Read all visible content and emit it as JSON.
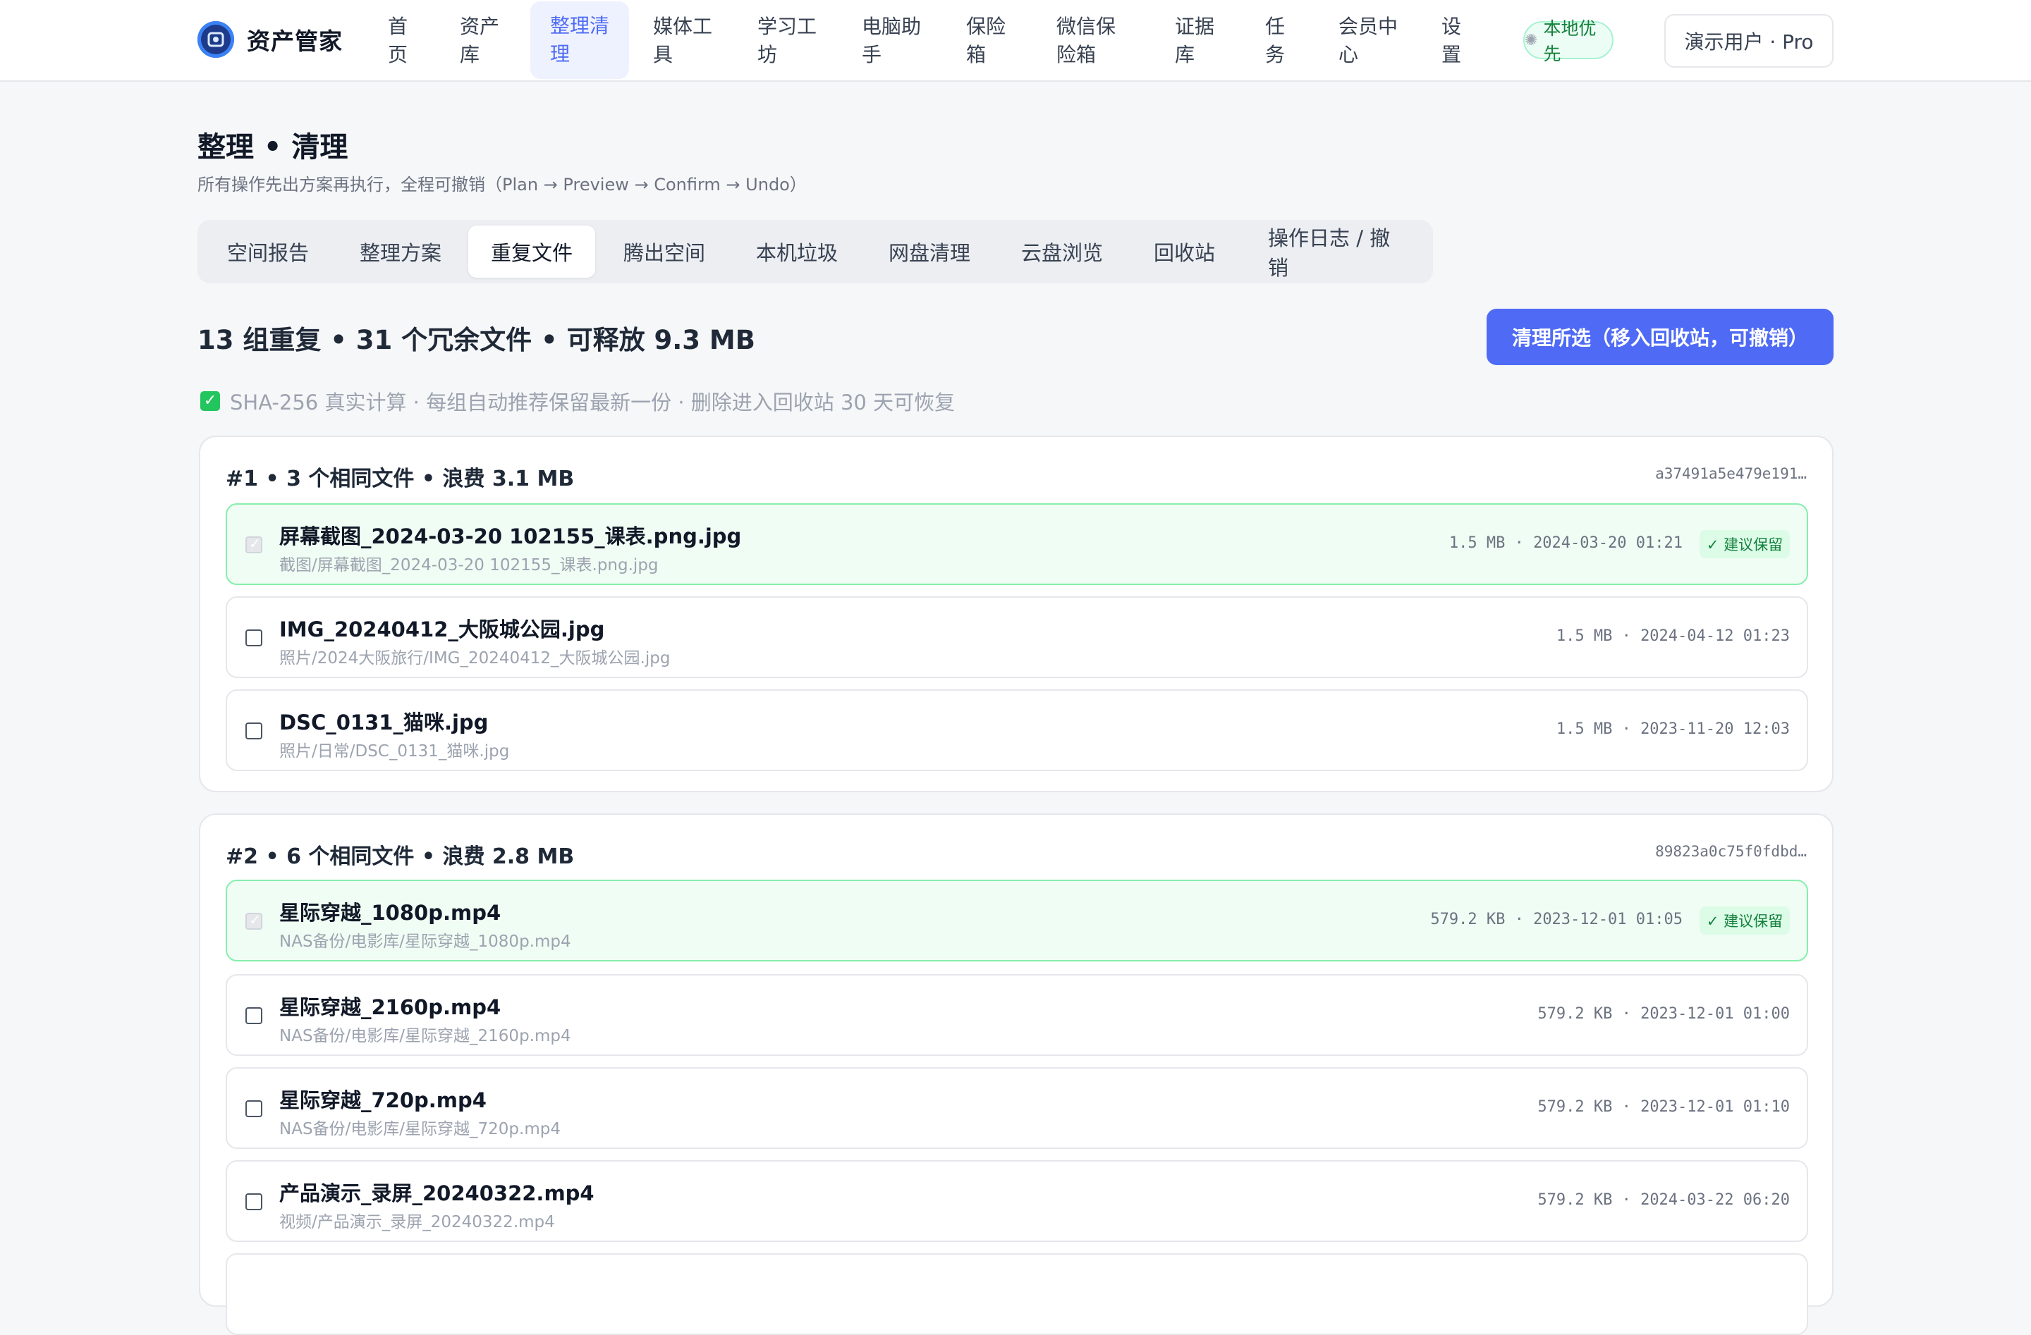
{
  "brand": {
    "name": "资产管家"
  },
  "nav": [
    {
      "label": "首\n页"
    },
    {
      "label": "资产\n库"
    },
    {
      "label": "整理清\n理"
    },
    {
      "label": "媒体工\n具"
    },
    {
      "label": "学习工\n坊"
    },
    {
      "label": "电脑助\n手"
    },
    {
      "label": "保险\n箱"
    },
    {
      "label": "微信保\n险箱"
    },
    {
      "label": "证据\n库"
    },
    {
      "label": "任\n务"
    },
    {
      "label": "会员中\n心"
    },
    {
      "label": "设\n置"
    }
  ],
  "nav_active": "整理清理",
  "local_badge": "本地优先",
  "user": "演示用户 · Pro",
  "page": {
    "title": "整理 • 清理",
    "subtitle": "所有操作先出方案再执行，全程可撤销（Plan → Preview → Confirm → Undo）"
  },
  "tabs": [
    {
      "label": "空间报告"
    },
    {
      "label": "整理方案"
    },
    {
      "label": "重复文件"
    },
    {
      "label": "腾出空间"
    },
    {
      "label": "本机垃圾"
    },
    {
      "label": "网盘清理"
    },
    {
      "label": "云盘浏览"
    },
    {
      "label": "回收站"
    },
    {
      "label": "操作日志 / 撤销"
    }
  ],
  "tab_active": "重复文件",
  "summary": "13 组重复 • 31 个冗余文件 • 可释放 9.3 MB",
  "primary_action": "清理所选（移入回收站，可撤销）",
  "note": "SHA-256 真实计算 · 每组自动推荐保留最新一份 · 删除进入回收站 30 天可恢复",
  "keep_badge": "✓ 建议保留",
  "groups": [
    {
      "title": "#1 • 3 个相同文件 • 浪费 3.1 MB",
      "hash": "a37491a5e479e191…",
      "files": [
        {
          "name": "屏幕截图_2024-03-20 102155_课表.png.jpg",
          "path": "截图/屏幕截图_2024-03-20 102155_课表.png.jpg",
          "meta": "1.5 MB · 2024-03-20 01:21",
          "keep": true
        },
        {
          "name": "IMG_20240412_大阪城公园.jpg",
          "path": "照片/2024大阪旅行/IMG_20240412_大阪城公园.jpg",
          "meta": "1.5 MB · 2024-04-12 01:23",
          "keep": false
        },
        {
          "name": "DSC_0131_猫咪.jpg",
          "path": "照片/日常/DSC_0131_猫咪.jpg",
          "meta": "1.5 MB · 2023-11-20 12:03",
          "keep": false
        }
      ]
    },
    {
      "title": "#2 • 6 个相同文件 • 浪费 2.8 MB",
      "hash": "89823a0c75f0fdbd…",
      "files": [
        {
          "name": "星际穿越_1080p.mp4",
          "path": "NAS备份/电影库/星际穿越_1080p.mp4",
          "meta": "579.2 KB · 2023-12-01 01:05",
          "keep": true
        },
        {
          "name": "星际穿越_2160p.mp4",
          "path": "NAS备份/电影库/星际穿越_2160p.mp4",
          "meta": "579.2 KB · 2023-12-01 01:00",
          "keep": false
        },
        {
          "name": "星际穿越_720p.mp4",
          "path": "NAS备份/电影库/星际穿越_720p.mp4",
          "meta": "579.2 KB · 2023-12-01 01:10",
          "keep": false
        },
        {
          "name": "产品演示_录屏_20240322.mp4",
          "path": "视频/产品演示_录屏_20240322.mp4",
          "meta": "579.2 KB · 2024-03-22 06:20",
          "keep": false
        }
      ]
    }
  ]
}
